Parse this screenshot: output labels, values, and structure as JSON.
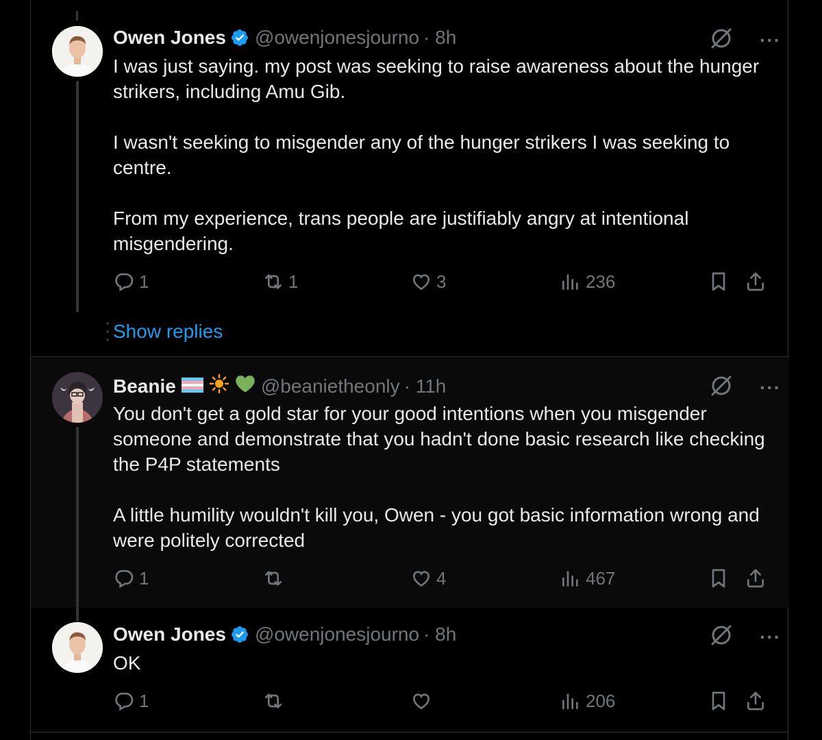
{
  "tweets": [
    {
      "name": "Owen Jones",
      "handle": "@owenjonesjourno",
      "time": "· 8h",
      "text": "I was just saying. my post was seeking to raise awareness about the hunger strikers, including Amu Gib.\n\nI wasn't seeking to misgender any of the hunger strikers I was seeking to centre.\n\nFrom my experience, trans people are justifiably angry at intentional misgendering.",
      "replies": "1",
      "retweets": "1",
      "likes": "3",
      "views": "236"
    },
    {
      "name": "Beanie",
      "handle": "@beanietheonly",
      "time": "· 11h",
      "text": "You don't get a gold star for your good intentions when you misgender someone and demonstrate that you hadn't done basic research like checking the P4P statements\n\nA little humility wouldn't kill you, Owen - you got basic information wrong and were politely corrected",
      "replies": "1",
      "retweets": "",
      "likes": "4",
      "views": "467"
    },
    {
      "name": "Owen Jones",
      "handle": "@owenjonesjourno",
      "time": "· 8h",
      "text": "OK",
      "replies": "1",
      "retweets": "",
      "likes": "",
      "views": "206"
    }
  ],
  "show_replies_label": "Show replies",
  "more_label": "···",
  "colors": {
    "background": "#000000",
    "text": "#e7e9ea",
    "muted": "#71767b",
    "link": "#1d9bf0",
    "verified": "#1d9bf0",
    "border": "#2f3336"
  },
  "icons": [
    "reply-icon",
    "retweet-icon",
    "like-icon",
    "views-icon",
    "bookmark-icon",
    "share-icon",
    "grok-icon",
    "verified-icon"
  ]
}
